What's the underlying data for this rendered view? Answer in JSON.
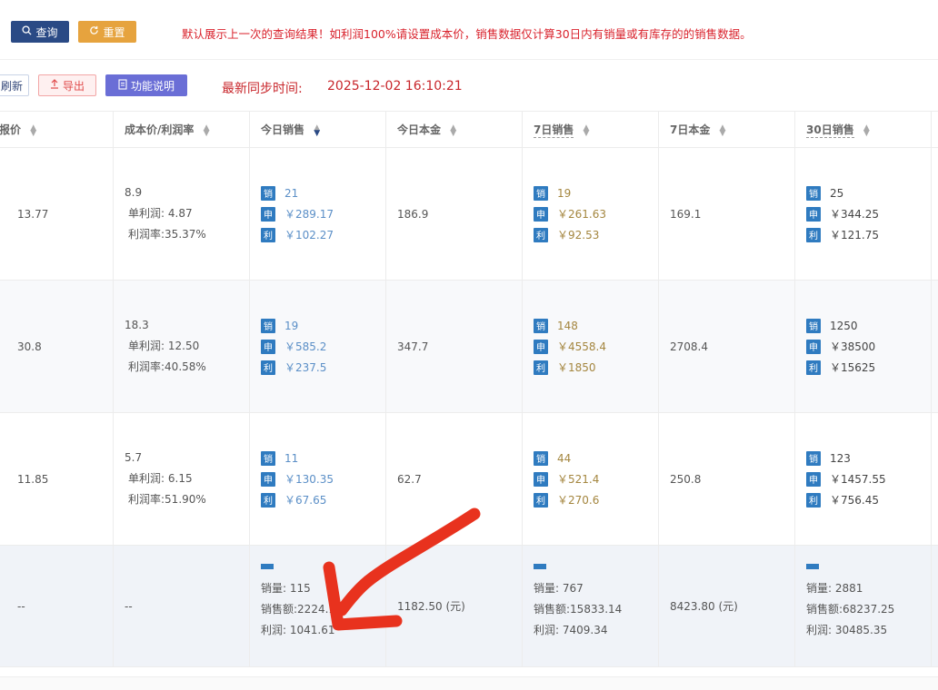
{
  "toolbar": {
    "query_label": "查询",
    "reset_label": "重置",
    "notice": "默认展示上一次的查询结果！如利润100%请设置成本价，销售数据仅计算30日内有销量或有库存的的销售数据。",
    "refresh_label": "刷新",
    "export_label": "导出",
    "help_label": "功能说明",
    "sync_label": "最新同步时间:",
    "sync_time": "2025-12-02 16:10:21"
  },
  "columns": [
    "申报价",
    "成本价/利润率",
    "今日销售",
    "今日本金",
    "7日销售",
    "7日本金",
    "30日销售"
  ],
  "tags": {
    "sales": "销",
    "declare": "申",
    "profit": "利"
  },
  "labels": {
    "unit_profit": "单利润:",
    "profit_rate": "利润率:"
  },
  "rows": [
    {
      "declare_price": "13.77",
      "cost": "8.9",
      "unit_profit": "4.87",
      "profit_rate": "35.37%",
      "today": {
        "qty": "21",
        "declare": "￥289.17",
        "profit": "￥102.27"
      },
      "today_principal": "186.9",
      "d7": {
        "qty": "19",
        "declare": "￥261.63",
        "profit": "￥92.53"
      },
      "d7_principal": "169.1",
      "d30": {
        "qty": "25",
        "declare": "￥344.25",
        "profit": "￥121.75"
      }
    },
    {
      "declare_price": "30.8",
      "cost": "18.3",
      "unit_profit": "12.50",
      "profit_rate": "40.58%",
      "today": {
        "qty": "19",
        "declare": "￥585.2",
        "profit": "￥237.5"
      },
      "today_principal": "347.7",
      "d7": {
        "qty": "148",
        "declare": "￥4558.4",
        "profit": "￥1850"
      },
      "d7_principal": "2708.4",
      "d30": {
        "qty": "1250",
        "declare": "￥38500",
        "profit": "￥15625"
      }
    },
    {
      "declare_price": "11.85",
      "cost": "5.7",
      "unit_profit": "6.15",
      "profit_rate": "51.90%",
      "today": {
        "qty": "11",
        "declare": "￥130.35",
        "profit": "￥67.65"
      },
      "today_principal": "62.7",
      "d7": {
        "qty": "44",
        "declare": "￥521.4",
        "profit": "￥270.6"
      },
      "d7_principal": "250.8",
      "d30": {
        "qty": "123",
        "declare": "￥1457.55",
        "profit": "￥756.45"
      }
    }
  ],
  "summary": {
    "declare_price": "--",
    "cost": "--",
    "today": {
      "qty": "销量:  115",
      "amount": "销售额:2224.1",
      "profit": "利润:  1041.61"
    },
    "today_principal": "1182.50 (元)",
    "d7": {
      "qty": "销量:  767",
      "amount": "销售额:15833.14",
      "profit": "利润:  7409.34"
    },
    "d7_principal": "8423.80 (元)",
    "d30": {
      "qty": "销量:  2881",
      "amount": "销售额:68237.25",
      "profit": "利润:  30485.35"
    }
  },
  "colors": {
    "primary": "#2a4a85",
    "warning": "#e6a33e",
    "danger": "#d9232d",
    "tag": "#2f7bc0",
    "annotation": "#e8321e"
  },
  "annotation": {
    "type": "red-arrow",
    "points_to": "summary.today.amount"
  }
}
